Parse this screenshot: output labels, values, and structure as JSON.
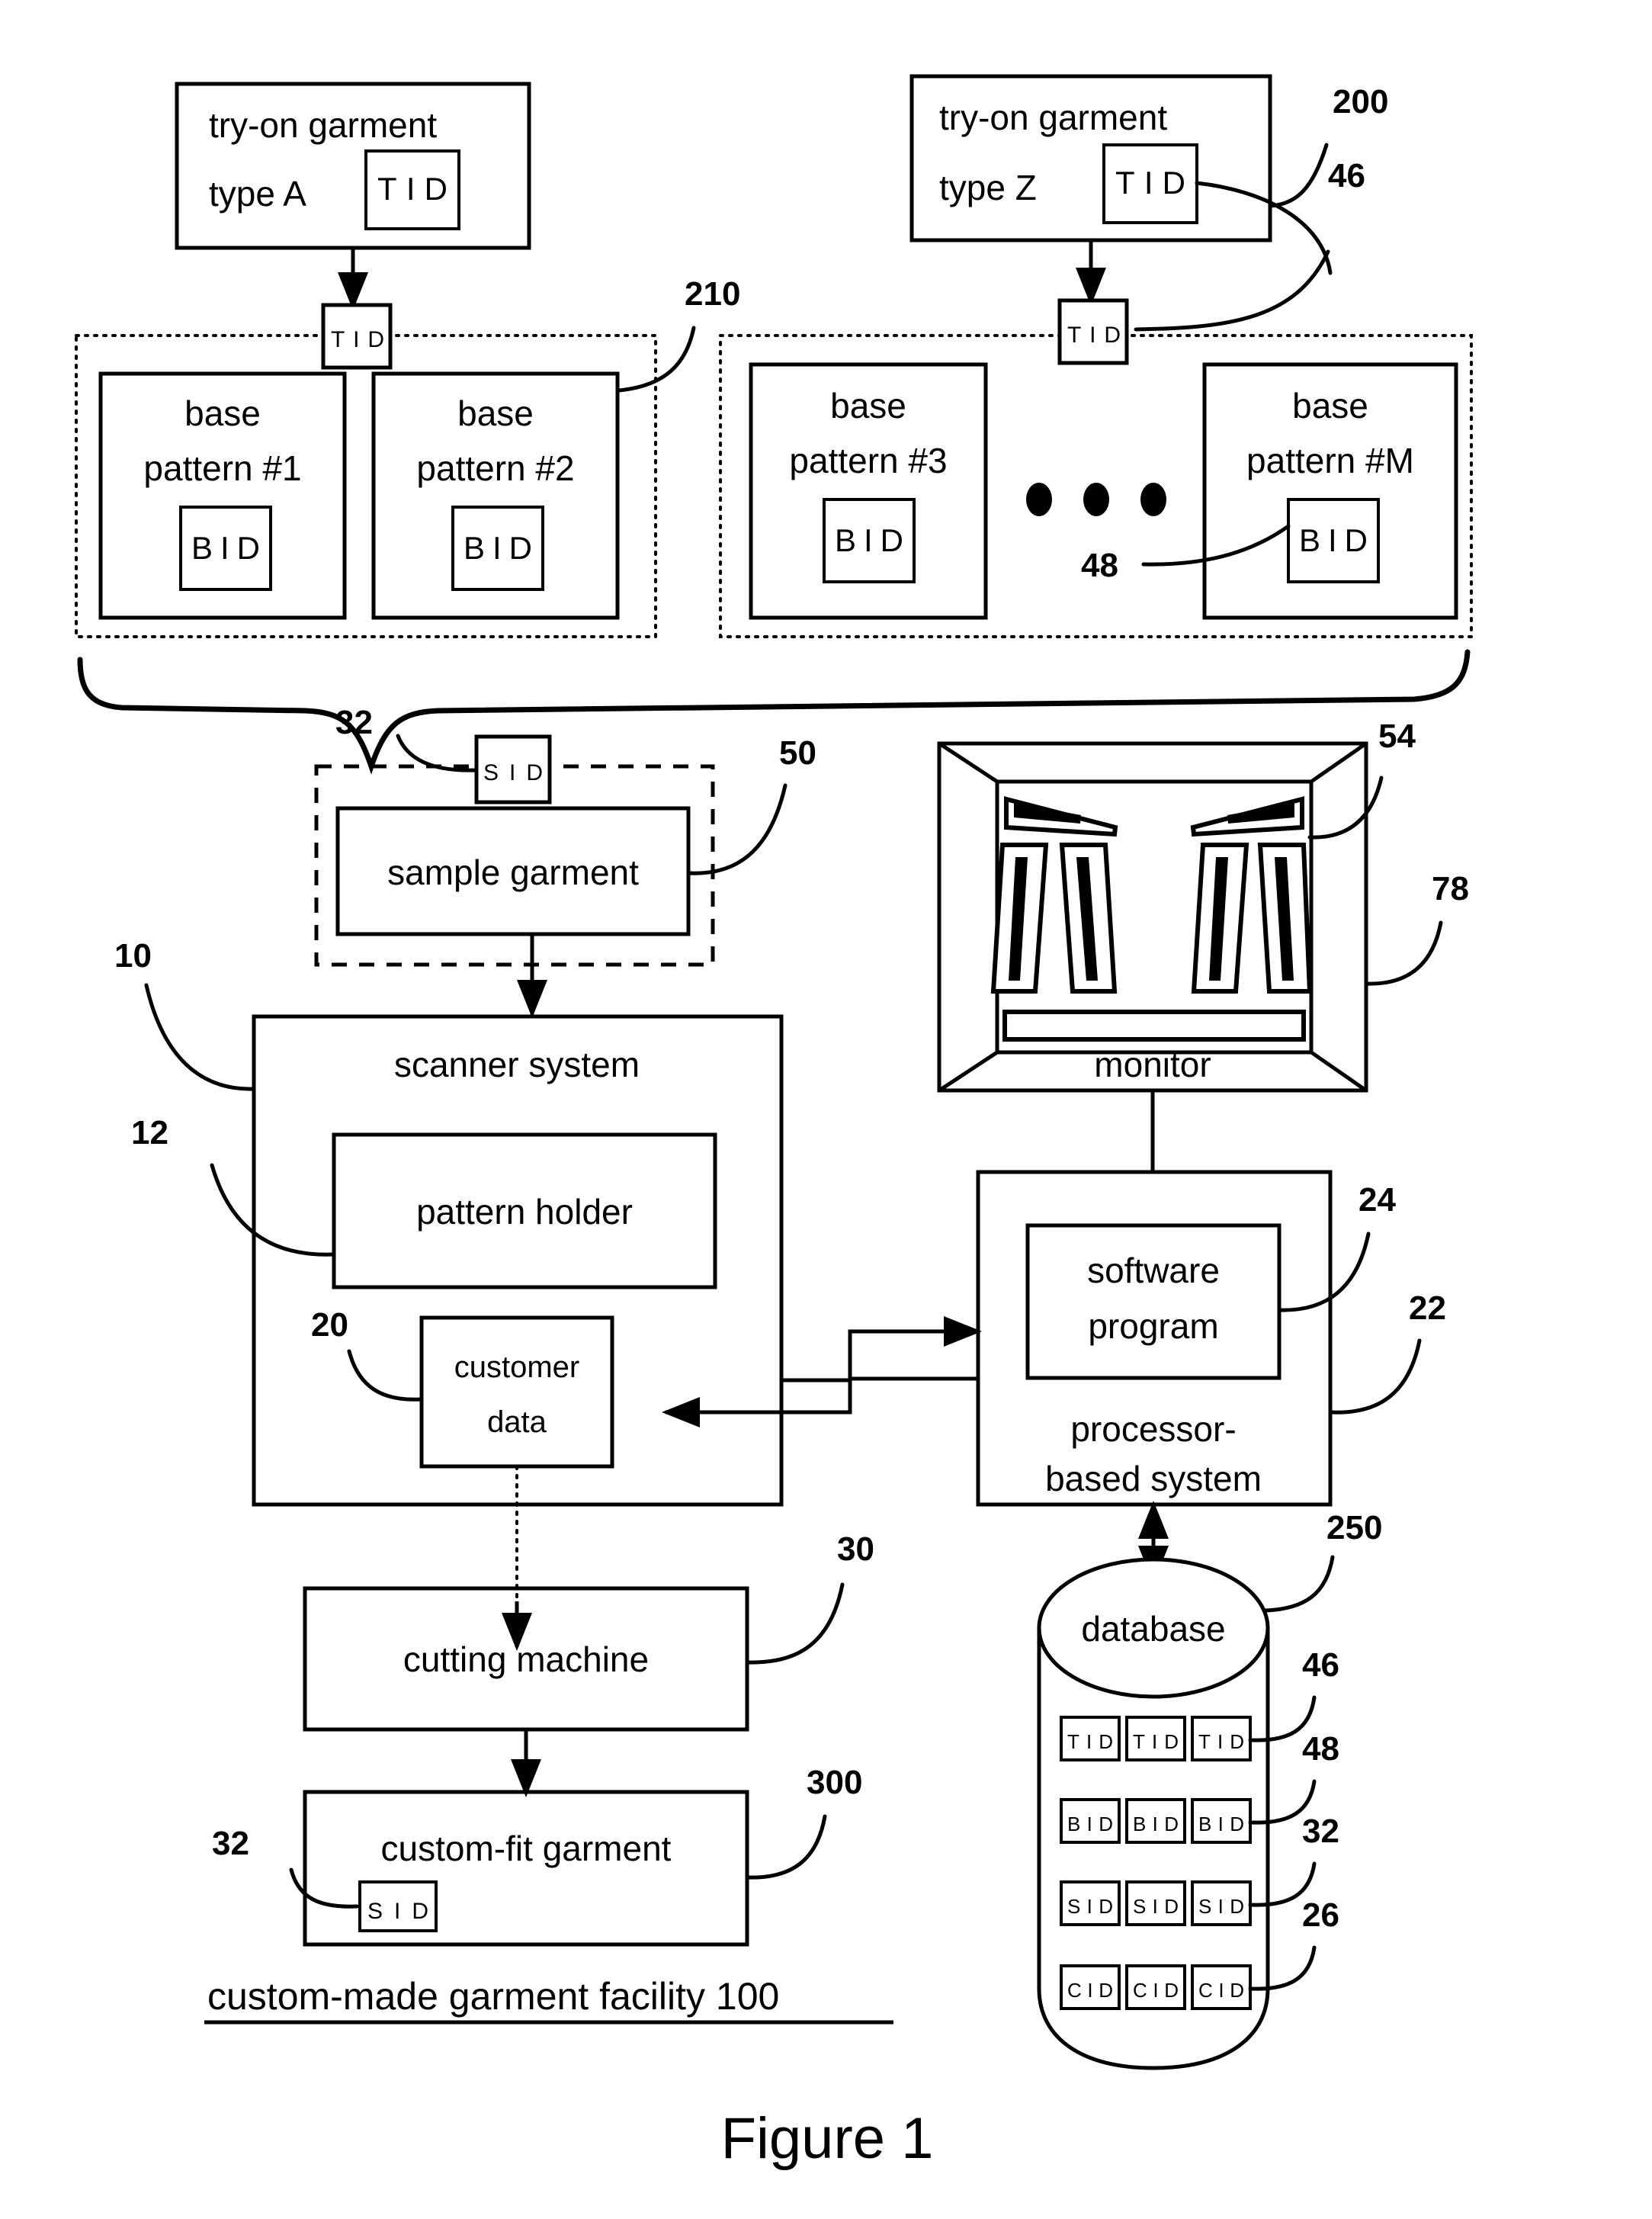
{
  "figure": {
    "label": "Figure 1",
    "caption": "custom-made garment facility 100"
  },
  "try_on_garments": [
    {
      "line1": "try-on garment",
      "line2": "type A",
      "tag": "TID"
    },
    {
      "line1": "try-on garment",
      "line2": "type Z",
      "tag": "TID",
      "ref": "200"
    }
  ],
  "tid_connector_tags": {
    "left": "TID",
    "right": "TID",
    "right_ref": "46"
  },
  "pattern_groups": [
    {
      "ref": "210",
      "patterns": [
        {
          "line1": "base",
          "line2": "pattern #1",
          "tag": "BID"
        },
        {
          "line1": "base",
          "line2": "pattern #2",
          "tag": "BID"
        }
      ]
    },
    {
      "patterns": [
        {
          "line1": "base",
          "line2": "pattern #3",
          "tag": "BID"
        },
        {
          "line1": "base",
          "line2": "pattern #M",
          "tag": "BID",
          "tag_ref": "48"
        }
      ],
      "ellipsis": "• • •"
    }
  ],
  "sample_group": {
    "sid_tag": "SID",
    "sid_ref": "32",
    "garment_label": "sample garment",
    "garment_ref": "50"
  },
  "scanner": {
    "title": "scanner system",
    "ref": "10",
    "pattern_holder": {
      "label": "pattern holder",
      "ref": "12"
    },
    "customer_data": {
      "line1": "customer",
      "line2": "data",
      "ref": "20"
    }
  },
  "monitor": {
    "label": "monitor",
    "screen_ref": "54",
    "frame_ref": "78"
  },
  "processor": {
    "line1": "processor-",
    "line2": "based system",
    "ref": "22",
    "software": {
      "line1": "software",
      "line2": "program",
      "ref": "24"
    }
  },
  "cutting_machine": {
    "label": "cutting machine",
    "ref": "30"
  },
  "custom_fit_garment": {
    "label": "custom-fit garment",
    "tag": "SID",
    "tag_ref": "32",
    "ref": "300"
  },
  "database": {
    "label": "database",
    "ref": "250",
    "rows": [
      {
        "tag": "TID",
        "ref": "46",
        "cells": [
          "TID",
          "TID",
          "TID"
        ]
      },
      {
        "tag": "BID",
        "ref": "48",
        "cells": [
          "BID",
          "BID",
          "BID"
        ]
      },
      {
        "tag": "SID",
        "ref": "32",
        "cells": [
          "SID",
          "SID",
          "SID"
        ]
      },
      {
        "tag": "CID",
        "ref": "26",
        "cells": [
          "CID",
          "CID",
          "CID"
        ]
      }
    ]
  },
  "colors": {
    "ink": "#000000",
    "paper": "#ffffff"
  }
}
